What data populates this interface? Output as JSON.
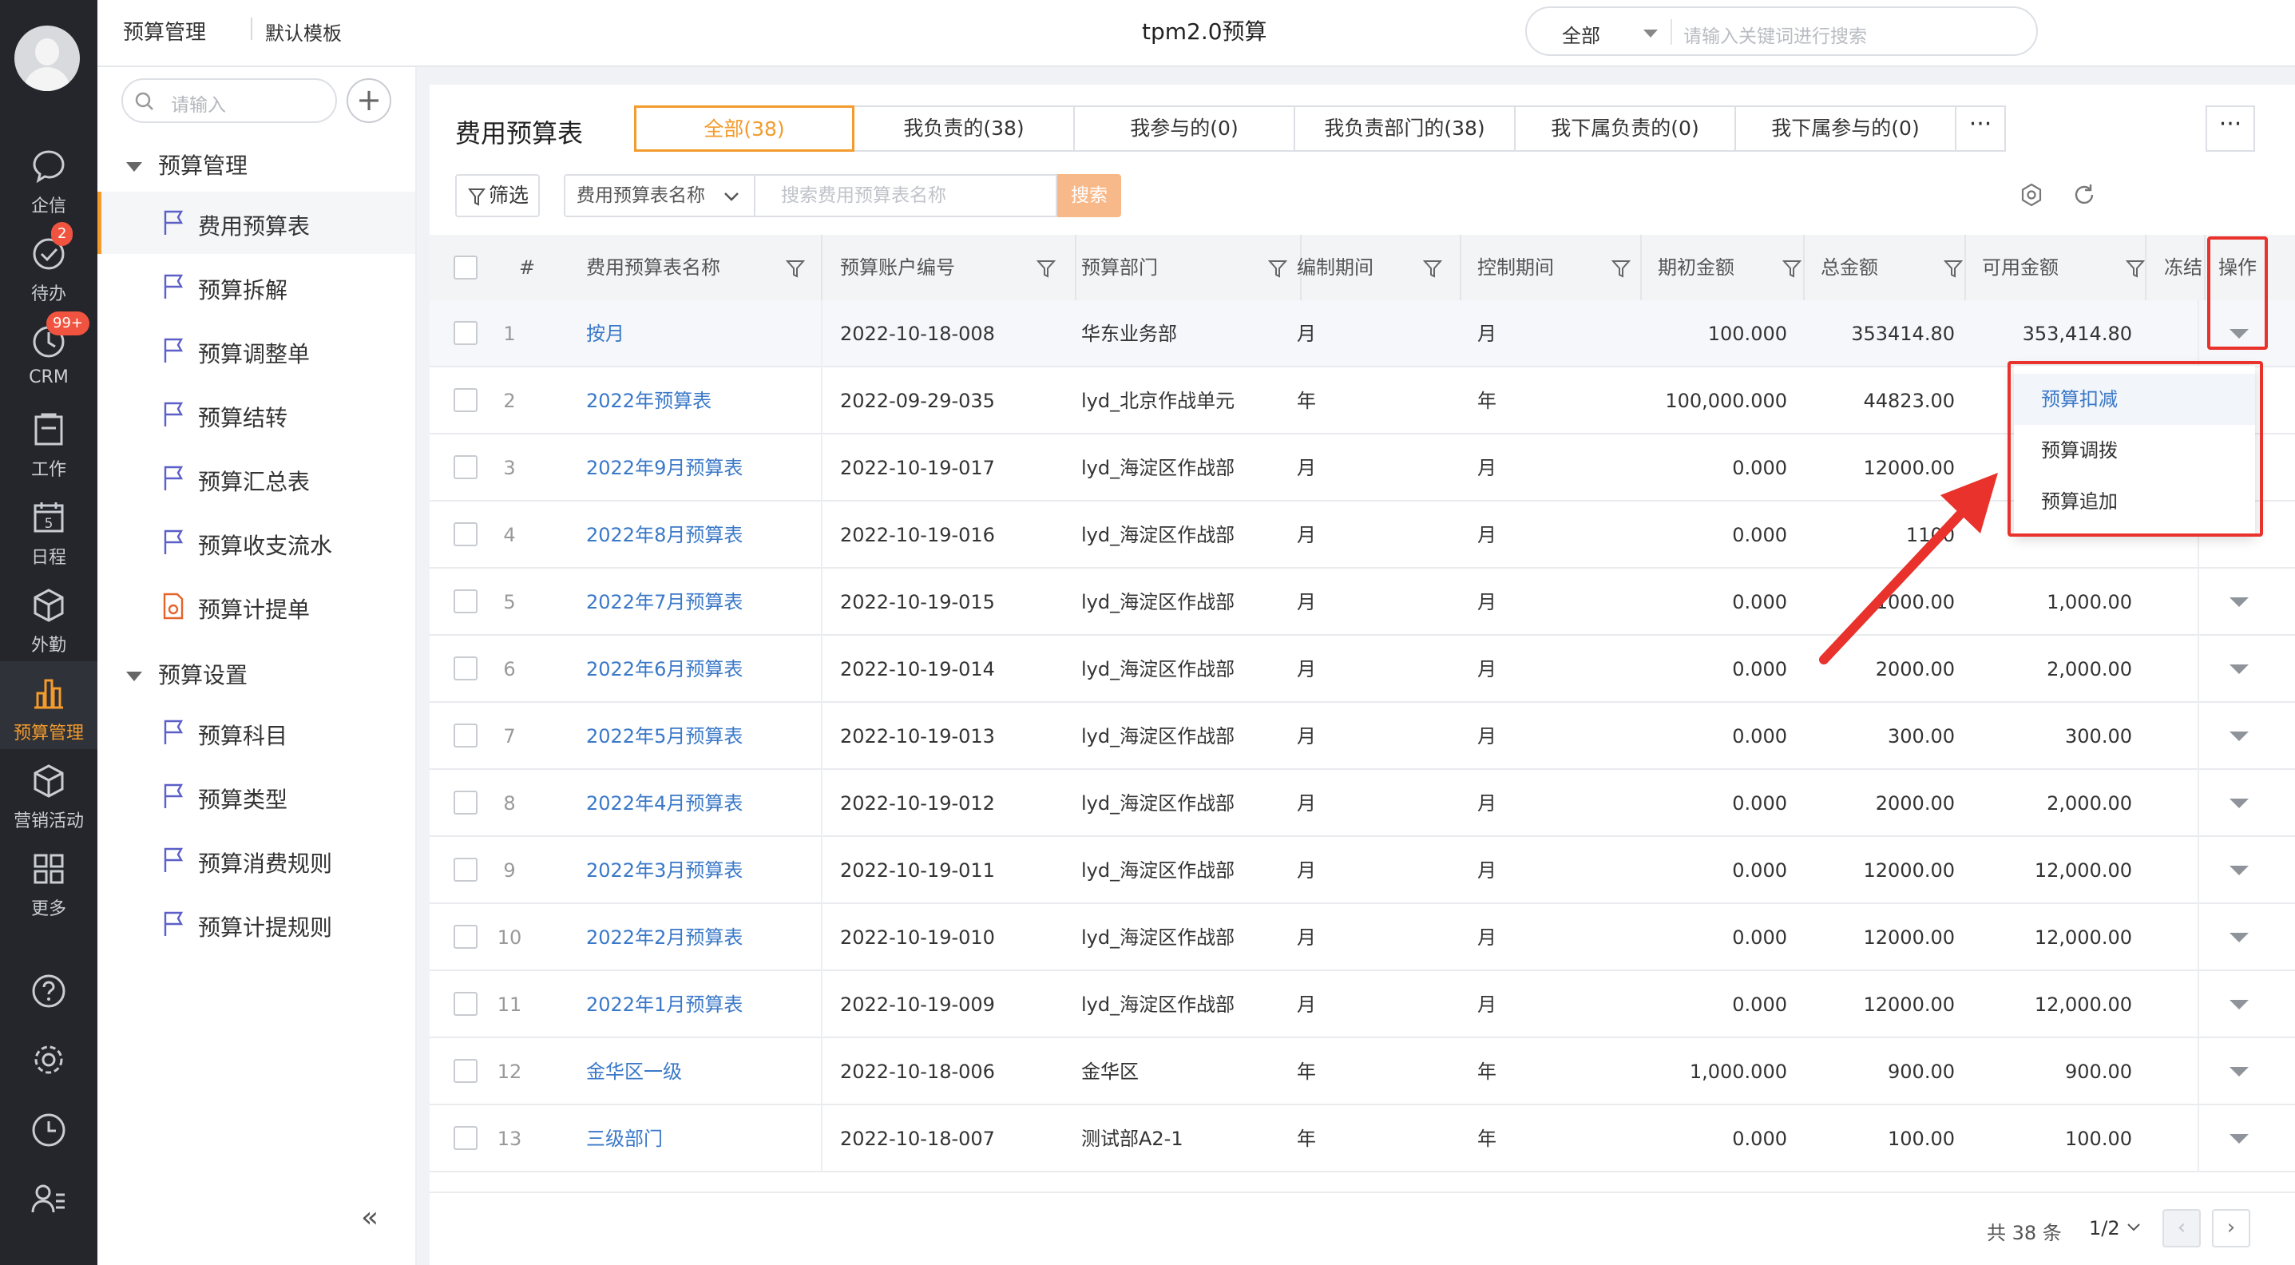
{
  "rail": {
    "items": [
      {
        "label": "企信",
        "icon": "chat-icon"
      },
      {
        "label": "待办",
        "icon": "check-circle-icon",
        "badge": "2"
      },
      {
        "label": "CRM",
        "icon": "crm-clock-icon",
        "badge": "99+"
      },
      {
        "label": "工作",
        "icon": "clipboard-icon"
      },
      {
        "label": "日程",
        "icon": "calendar-icon",
        "day": "5"
      },
      {
        "label": "外勤",
        "icon": "cube-icon"
      },
      {
        "label": "预算管理",
        "icon": "bar-chart-icon",
        "active": true
      },
      {
        "label": "营销活动",
        "icon": "box-icon"
      },
      {
        "label": "更多",
        "icon": "grid-icon"
      }
    ]
  },
  "header": {
    "breadcrumb_main": "预算管理",
    "breadcrumb_template": "默认模板",
    "app_title": "tpm2.0预算",
    "search_scope": "全部",
    "search_placeholder": "请输入关键词进行搜索"
  },
  "sidebar": {
    "search_placeholder": "请输入",
    "groups": [
      {
        "label": "预算管理",
        "items": [
          "费用预算表",
          "预算拆解",
          "预算调整单",
          "预算结转",
          "预算汇总表",
          "预算收支流水",
          "预算计提单"
        ]
      },
      {
        "label": "预算设置",
        "items": [
          "预算科目",
          "预算类型",
          "预算消费规则",
          "预算计提规则"
        ]
      }
    ]
  },
  "main": {
    "title": "费用预算表",
    "tabs": [
      "全部(38)",
      "我负责的(38)",
      "我参与的(0)",
      "我负责部门的(38)",
      "我下属负责的(0)",
      "我下属参与的(0)"
    ],
    "tab_more": "···",
    "card_more": "···",
    "filter_label": "筛选",
    "search_field_select": "费用预算表名称",
    "search_placeholder": "搜索费用预算表名称",
    "search_button": "搜索"
  },
  "table": {
    "columns": [
      "#",
      "费用预算表名称",
      "预算账户编号",
      "预算部门",
      "编制期间",
      "控制期间",
      "期初金额",
      "总金额",
      "可用金额",
      "冻结",
      "操作"
    ],
    "rows": [
      {
        "idx": "1",
        "name": "按月",
        "code": "2022-10-18-008",
        "dept": "华东业务部",
        "plan": "月",
        "ctrl": "月",
        "init": "100.000",
        "total": "353414.80",
        "avail": "353,414.80"
      },
      {
        "idx": "2",
        "name": "2022年预算表",
        "code": "2022-09-29-035",
        "dept": "lyd_北京作战单元",
        "plan": "年",
        "ctrl": "年",
        "init": "100,000.000",
        "total": "44823.00",
        "avail": ""
      },
      {
        "idx": "3",
        "name": "2022年9月预算表",
        "code": "2022-10-19-017",
        "dept": "lyd_海淀区作战部",
        "plan": "月",
        "ctrl": "月",
        "init": "0.000",
        "total": "12000.00",
        "avail": ""
      },
      {
        "idx": "4",
        "name": "2022年8月预算表",
        "code": "2022-10-19-016",
        "dept": "lyd_海淀区作战部",
        "plan": "月",
        "ctrl": "月",
        "init": "0.000",
        "total": "1100",
        "avail": ""
      },
      {
        "idx": "5",
        "name": "2022年7月预算表",
        "code": "2022-10-19-015",
        "dept": "lyd_海淀区作战部",
        "plan": "月",
        "ctrl": "月",
        "init": "0.000",
        "total": "1000.00",
        "avail": "1,000.00"
      },
      {
        "idx": "6",
        "name": "2022年6月预算表",
        "code": "2022-10-19-014",
        "dept": "lyd_海淀区作战部",
        "plan": "月",
        "ctrl": "月",
        "init": "0.000",
        "total": "2000.00",
        "avail": "2,000.00"
      },
      {
        "idx": "7",
        "name": "2022年5月预算表",
        "code": "2022-10-19-013",
        "dept": "lyd_海淀区作战部",
        "plan": "月",
        "ctrl": "月",
        "init": "0.000",
        "total": "300.00",
        "avail": "300.00"
      },
      {
        "idx": "8",
        "name": "2022年4月预算表",
        "code": "2022-10-19-012",
        "dept": "lyd_海淀区作战部",
        "plan": "月",
        "ctrl": "月",
        "init": "0.000",
        "total": "2000.00",
        "avail": "2,000.00"
      },
      {
        "idx": "9",
        "name": "2022年3月预算表",
        "code": "2022-10-19-011",
        "dept": "lyd_海淀区作战部",
        "plan": "月",
        "ctrl": "月",
        "init": "0.000",
        "total": "12000.00",
        "avail": "12,000.00"
      },
      {
        "idx": "10",
        "name": "2022年2月预算表",
        "code": "2022-10-19-010",
        "dept": "lyd_海淀区作战部",
        "plan": "月",
        "ctrl": "月",
        "init": "0.000",
        "total": "12000.00",
        "avail": "12,000.00"
      },
      {
        "idx": "11",
        "name": "2022年1月预算表",
        "code": "2022-10-19-009",
        "dept": "lyd_海淀区作战部",
        "plan": "月",
        "ctrl": "月",
        "init": "0.000",
        "total": "12000.00",
        "avail": "12,000.00"
      },
      {
        "idx": "12",
        "name": "金华区一级",
        "code": "2022-10-18-006",
        "dept": "金华区",
        "plan": "年",
        "ctrl": "年",
        "init": "1,000.000",
        "total": "900.00",
        "avail": "900.00"
      },
      {
        "idx": "13",
        "name": "三级部门",
        "code": "2022-10-18-007",
        "dept": "测试部A2-1",
        "plan": "年",
        "ctrl": "年",
        "init": "0.000",
        "total": "100.00",
        "avail": "100.00"
      }
    ]
  },
  "dropdown": {
    "items": [
      "预算扣减",
      "预算调拨",
      "预算追加"
    ]
  },
  "pager": {
    "total": "共 38 条",
    "page": "1/2"
  },
  "colors": {
    "accent": "#f39b2d",
    "link": "#3a78c8",
    "annotation": "#e8322b",
    "rail": "#24262b"
  }
}
